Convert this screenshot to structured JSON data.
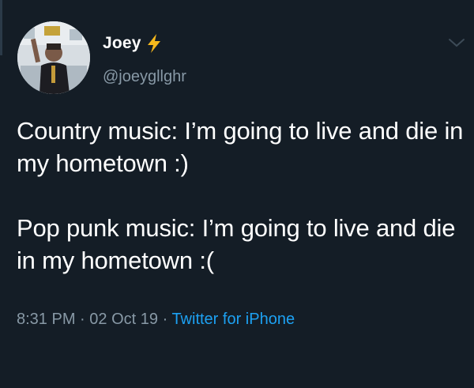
{
  "user": {
    "display_name": "Joey",
    "handle": "@joeygllghr",
    "badge_icon": "lightning-bolt-icon",
    "avatar_icon": "avatar-photo"
  },
  "tweet": {
    "line_one": "Country music: I’m going to live and die in my hometown :)",
    "line_two": "Pop punk music: I’m going to live and die in my hometown :("
  },
  "meta": {
    "time": "8:31 PM",
    "separator": "·",
    "date": "02 Oct 19",
    "source": "Twitter for iPhone"
  },
  "colors": {
    "background": "#141d26",
    "text": "#ffffff",
    "secondary": "#8899a6",
    "accent": "#1da1f2",
    "bolt": "#f5b81c"
  },
  "menu_icon": "chevron-down-icon"
}
